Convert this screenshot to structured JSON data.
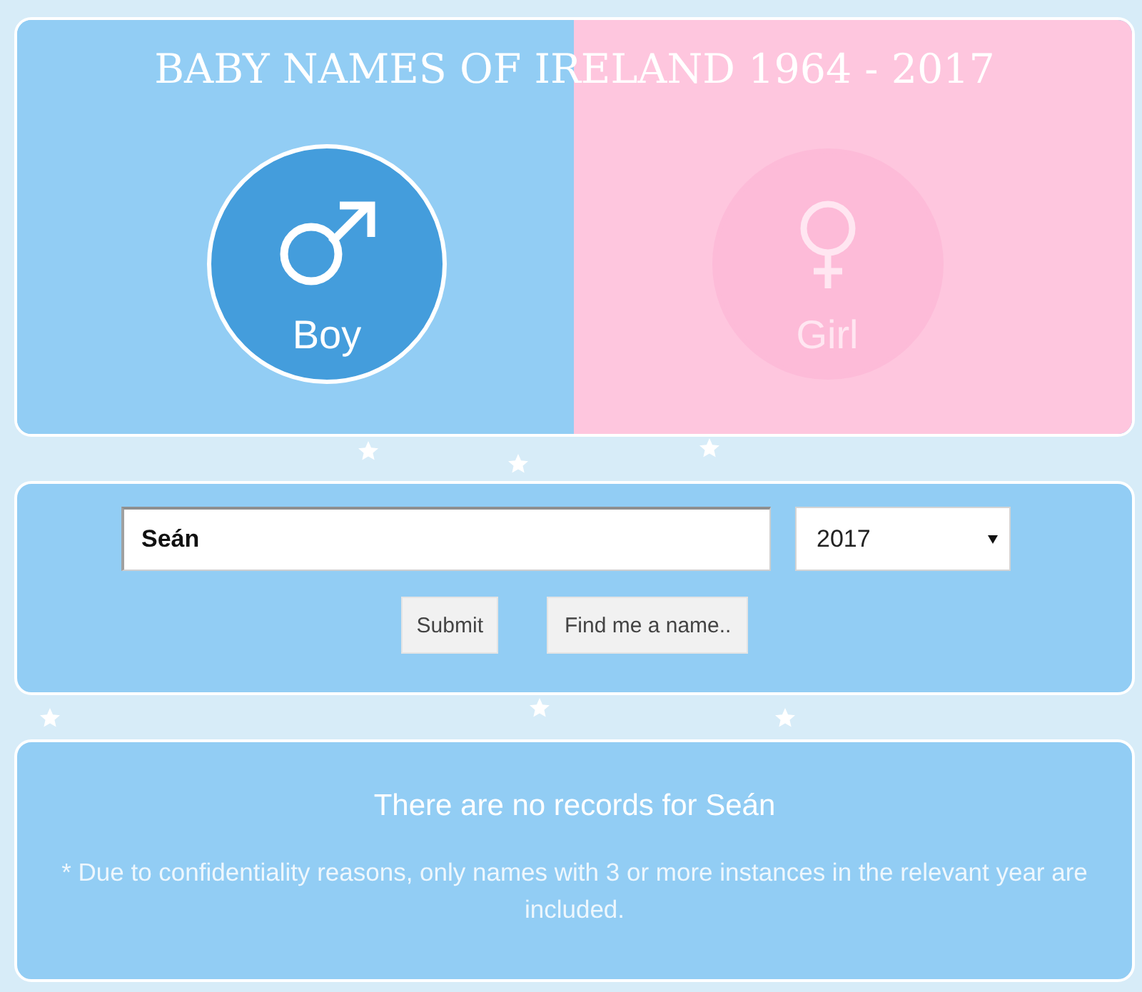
{
  "header": {
    "title": "BABY NAMES OF IRELAND 1964 - 2017",
    "genders": [
      {
        "kind": "male",
        "label": "Boy",
        "selected": true
      },
      {
        "kind": "female",
        "label": "Girl",
        "selected": false
      }
    ]
  },
  "search": {
    "name_field": {
      "value": "Seán"
    },
    "year_select": {
      "value": "2017"
    },
    "buttons": [
      "Submit",
      "Find me a name.."
    ]
  },
  "result": {
    "message": "There are no records for Seán",
    "note": "* Due to confidentiality reasons, only names with 3 or more instances in the relevant year are included."
  }
}
